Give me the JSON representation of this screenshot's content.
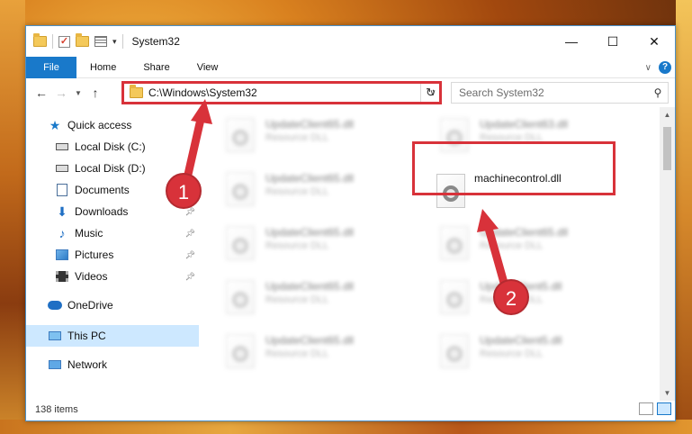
{
  "window": {
    "title": "System32",
    "controls": {
      "minimize": "—",
      "maximize": "☐",
      "close": "✕"
    }
  },
  "ribbon": {
    "tabs": [
      {
        "label": "File",
        "active": true
      },
      {
        "label": "Home"
      },
      {
        "label": "Share"
      },
      {
        "label": "View"
      }
    ]
  },
  "navigation": {
    "address": "C:\\Windows\\System32",
    "search_placeholder": "Search System32"
  },
  "sidebar": {
    "items": [
      {
        "label": "Quick access",
        "icon": "star-icon"
      },
      {
        "label": "Local Disk (C:)",
        "icon": "drive-icon"
      },
      {
        "label": "Local Disk (D:)",
        "icon": "drive-icon"
      },
      {
        "label": "Documents",
        "icon": "document-icon",
        "pinned": true
      },
      {
        "label": "Downloads",
        "icon": "download-icon",
        "pinned": true
      },
      {
        "label": "Music",
        "icon": "music-icon",
        "pinned": true
      },
      {
        "label": "Pictures",
        "icon": "picture-icon",
        "pinned": true
      },
      {
        "label": "Videos",
        "icon": "video-icon",
        "pinned": true
      },
      {
        "label": "OneDrive",
        "icon": "cloud-icon"
      },
      {
        "label": "This PC",
        "icon": "computer-icon",
        "selected": true
      },
      {
        "label": "Network",
        "icon": "network-icon"
      }
    ]
  },
  "files": [
    {
      "name": "UpdateClient65.dll",
      "type": "Resource DLL",
      "blurred": true
    },
    {
      "name": "UpdateClient63.dll",
      "type": "Resource DLL",
      "blurred": true
    },
    {
      "name": "UpdateClient65.dll",
      "type": "Resource DLL",
      "blurred": true
    },
    {
      "name": "machinecontrol.dll",
      "type": "",
      "blurred": false
    },
    {
      "name": "UpdateClient65.dll",
      "type": "Resource DLL",
      "blurred": true
    },
    {
      "name": "UpdateClient65.dll",
      "type": "Resource DLL",
      "blurred": true
    },
    {
      "name": "UpdateClient65.dll",
      "type": "Resource DLL",
      "blurred": true
    },
    {
      "name": "UpdateClient5.dll",
      "type": "Resource DLL",
      "blurred": true
    },
    {
      "name": "UpdateClient65.dll",
      "type": "Resource DLL",
      "blurred": true
    },
    {
      "name": "UpdateClient5.dll",
      "type": "Resource DLL",
      "blurred": true
    }
  ],
  "status": {
    "item_count": "138 items"
  },
  "annotations": {
    "step1": "1",
    "step2": "2",
    "highlight_color": "#d8323a"
  },
  "colors": {
    "accent": "#1979ca",
    "selection": "#cde8ff"
  }
}
